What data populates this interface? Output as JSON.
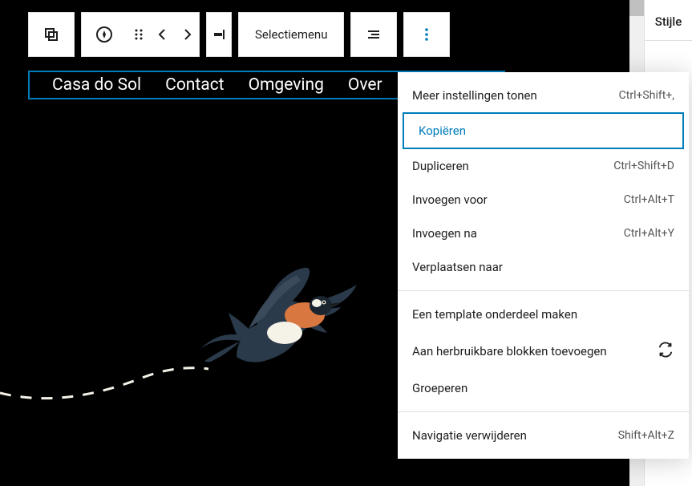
{
  "toolbar": {
    "select_menu_label": "Selectiemenu"
  },
  "nav": {
    "items": [
      "Casa do Sol",
      "Contact",
      "Omgeving",
      "Over"
    ]
  },
  "dropdown": {
    "section1": {
      "more_settings": {
        "label": "Meer instellingen tonen",
        "shortcut": "Ctrl+Shift+,"
      },
      "copy": {
        "label": "Kopiëren"
      },
      "duplicate": {
        "label": "Dupliceren",
        "shortcut": "Ctrl+Shift+D"
      },
      "insert_before": {
        "label": "Invoegen voor",
        "shortcut": "Ctrl+Alt+T"
      },
      "insert_after": {
        "label": "Invoegen na",
        "shortcut": "Ctrl+Alt+Y"
      },
      "move_to": {
        "label": "Verplaatsen naar"
      }
    },
    "section2": {
      "make_template": {
        "label": "Een template onderdeel maken"
      },
      "add_reusable": {
        "label": "Aan herbruikbare blokken toevoegen"
      },
      "group": {
        "label": "Groeperen"
      }
    },
    "section3": {
      "remove_nav": {
        "label": "Navigatie verwijderen",
        "shortcut": "Shift+Alt+Z"
      }
    }
  },
  "sidebar": {
    "tab_label": "Stijle"
  }
}
